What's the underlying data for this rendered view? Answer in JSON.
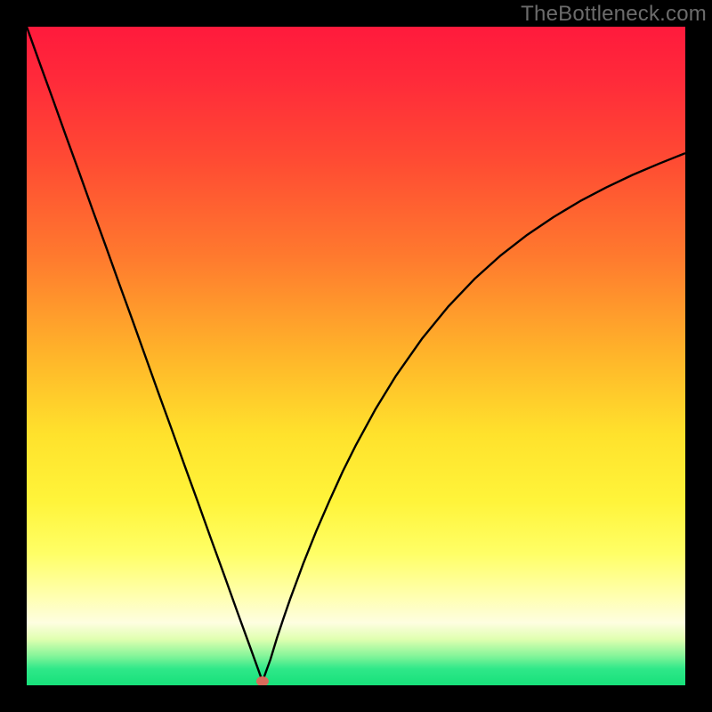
{
  "watermark_text": "TheBottleneck.com",
  "colors": {
    "frame_bg": "#000000",
    "curve_stroke": "#000000",
    "marker_fill": "#d96a5b",
    "gradient_stops": [
      {
        "offset": 0.0,
        "color": "#ff1a3c"
      },
      {
        "offset": 0.08,
        "color": "#ff2a3a"
      },
      {
        "offset": 0.2,
        "color": "#ff4a33"
      },
      {
        "offset": 0.35,
        "color": "#ff7a2e"
      },
      {
        "offset": 0.5,
        "color": "#ffb52a"
      },
      {
        "offset": 0.62,
        "color": "#ffe22c"
      },
      {
        "offset": 0.72,
        "color": "#fff43a"
      },
      {
        "offset": 0.8,
        "color": "#ffff66"
      },
      {
        "offset": 0.86,
        "color": "#ffffaa"
      },
      {
        "offset": 0.905,
        "color": "#fefee0"
      },
      {
        "offset": 0.93,
        "color": "#e0ffb0"
      },
      {
        "offset": 0.955,
        "color": "#86f59a"
      },
      {
        "offset": 0.975,
        "color": "#2fe889"
      },
      {
        "offset": 1.0,
        "color": "#17e07a"
      }
    ]
  },
  "chart_data": {
    "type": "line",
    "title": "",
    "xlabel": "",
    "ylabel": "",
    "xlim": [
      0,
      100
    ],
    "ylim": [
      0,
      100
    ],
    "legend_position": "none",
    "grid": false,
    "series": [
      {
        "name": "left-branch",
        "x": [
          0,
          2,
          4,
          6,
          8,
          10,
          12,
          14,
          16,
          18,
          20,
          22,
          24,
          26,
          28,
          30,
          32,
          34,
          35.8
        ],
        "y": [
          100,
          94.4,
          88.9,
          83.3,
          77.8,
          72.2,
          66.7,
          61.1,
          55.6,
          50.0,
          44.4,
          38.9,
          33.3,
          27.8,
          22.2,
          16.7,
          11.1,
          5.6,
          0.6
        ]
      },
      {
        "name": "right-branch",
        "x": [
          35.8,
          37,
          38,
          39,
          40,
          42,
          44,
          46,
          48,
          50,
          53,
          56,
          60,
          64,
          68,
          72,
          76,
          80,
          84,
          88,
          92,
          96,
          100
        ],
        "y": [
          0.6,
          3.9,
          7.2,
          10.2,
          13.1,
          18.5,
          23.5,
          28.1,
          32.5,
          36.5,
          42.0,
          46.9,
          52.6,
          57.5,
          61.7,
          65.3,
          68.4,
          71.1,
          73.5,
          75.6,
          77.5,
          79.2,
          80.8
        ]
      }
    ],
    "annotations": [
      {
        "name": "minimum-marker",
        "x": 35.8,
        "y": 0.6
      }
    ]
  }
}
